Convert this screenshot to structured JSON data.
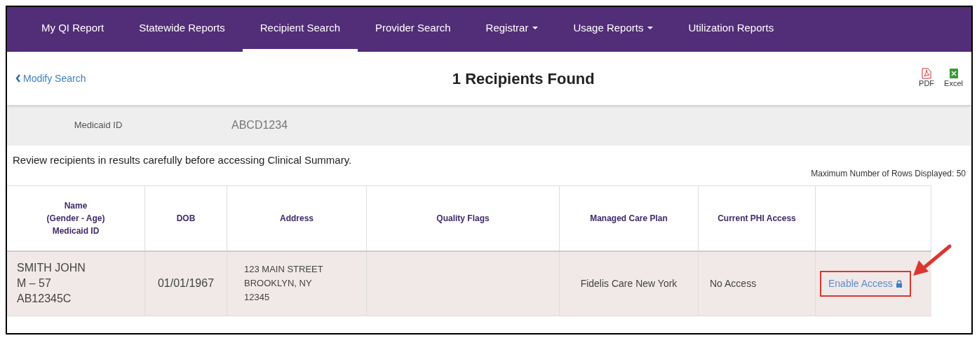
{
  "nav": [
    {
      "label": "My QI Report",
      "selected": false,
      "dropdown": false
    },
    {
      "label": "Statewide Reports",
      "selected": false,
      "dropdown": false
    },
    {
      "label": "Recipient Search",
      "selected": true,
      "dropdown": false
    },
    {
      "label": "Provider Search",
      "selected": false,
      "dropdown": false
    },
    {
      "label": "Registrar",
      "selected": false,
      "dropdown": true
    },
    {
      "label": "Usage Reports",
      "selected": false,
      "dropdown": true
    },
    {
      "label": "Utilization Reports",
      "selected": false,
      "dropdown": false
    }
  ],
  "back_link": "Modify Search",
  "title": "1 Recipients Found",
  "exports": [
    {
      "kind": "pdf",
      "label": "PDF"
    },
    {
      "kind": "excel",
      "label": "Excel"
    }
  ],
  "criteria": {
    "label": "Medicaid ID",
    "value": "ABCD1234"
  },
  "notice": "Review recipients in results carefully before accessing Clinical Summary.",
  "max_rows": "Maximum Number of Rows Displayed: 50",
  "table": {
    "columns": [
      [
        "Name",
        "(Gender - Age)",
        "Medicaid ID"
      ],
      [
        "DOB"
      ],
      [
        "Address"
      ],
      [
        "Quality Flags"
      ],
      [
        "Managed Care Plan"
      ],
      [
        "Current PHI Access"
      ],
      []
    ],
    "rows": [
      {
        "name": [
          "SMITH JOHN",
          "M – 57",
          "AB12345C"
        ],
        "dob": "01/01/1967",
        "address": [
          "123 MAIN STREET",
          "BROOKLYN, NY",
          "12345"
        ],
        "quality_flags": "",
        "plan": "Fidelis Care New York",
        "access": "No Access",
        "action": {
          "label": "Enable Access",
          "highlighted": true
        }
      }
    ]
  }
}
